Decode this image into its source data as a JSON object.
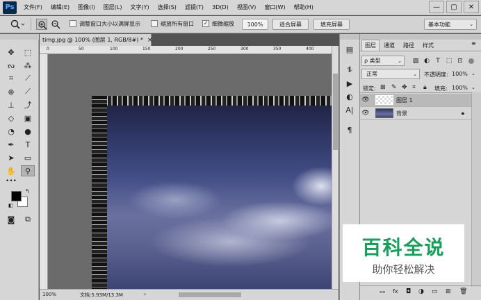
{
  "app": {
    "logo": "Ps"
  },
  "menu": [
    "文件(F)",
    "编辑(E)",
    "图像(I)",
    "图层(L)",
    "文字(Y)",
    "选择(S)",
    "滤镜(T)",
    "3D(D)",
    "视图(V)",
    "窗口(W)",
    "帮助(H)"
  ],
  "window_controls": {
    "minimize": "—",
    "maximize": "▢",
    "close": "✕"
  },
  "options": {
    "resize_window_label": "调整窗口大小以满屏显示",
    "zoom_all_label": "缩放所有窗口",
    "scrubby_zoom_label": "细微缩放",
    "zoom_value": "100%",
    "fit_screen": "适合屏幕",
    "fill_screen": "填充屏幕",
    "workspace": "基本功能"
  },
  "document": {
    "tab_title": "timg.jpg @ 100% (图层 1, RGB/8#) *",
    "close": "×",
    "ruler_numbers": [
      "0",
      "50",
      "100",
      "150",
      "200",
      "250",
      "300",
      "350",
      "400"
    ],
    "status_zoom": "100%",
    "status_doc": "文档:5.93M/13.3M"
  },
  "colors": {
    "accent": "#0b2a4a",
    "foreground": "#000000",
    "background": "#ffffff"
  },
  "layers_panel": {
    "tabs": [
      "图层",
      "通道",
      "路径",
      "样式"
    ],
    "filter_label": "ρ 类型",
    "blend_mode": "正常",
    "opacity_label": "不透明度:",
    "opacity_value": "100%",
    "lock_label": "锁定:",
    "fill_label": "填充:",
    "fill_value": "100%",
    "layers": [
      {
        "name": "图层 1",
        "selected": true
      },
      {
        "name": "背景",
        "selected": false
      }
    ]
  },
  "watermark": {
    "title": "百科全说",
    "subtitle": "助你轻松解决"
  }
}
